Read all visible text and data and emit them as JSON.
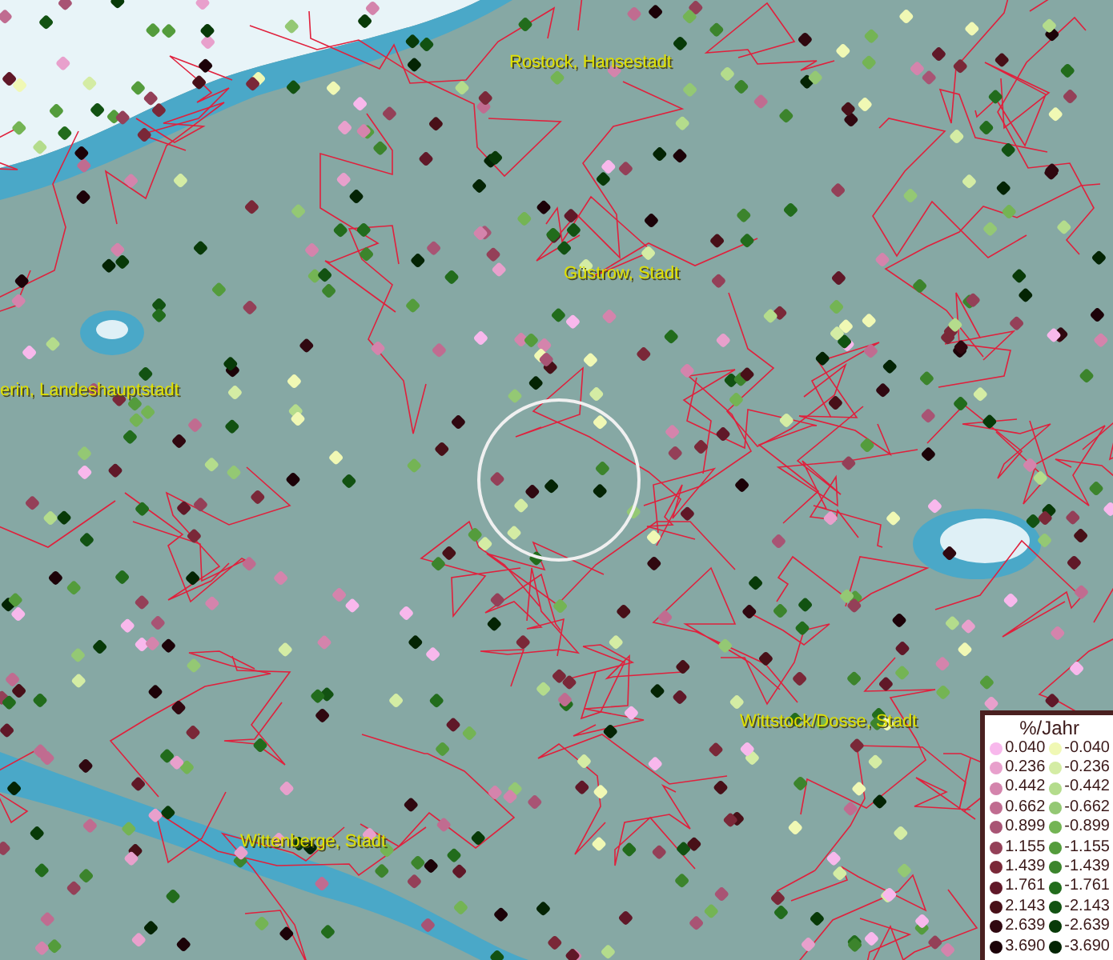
{
  "map": {
    "places": [
      {
        "name": "Rostock, Hansestadt"
      },
      {
        "name": "Güstrow, Stadt"
      },
      {
        "name": "erin, Landeshauptstadt"
      },
      {
        "name": "Wittstock/Dosse, Stadt"
      },
      {
        "name": "Wittenberge, Stadt"
      }
    ]
  },
  "legend": {
    "title": "%/Jahr",
    "increase": [
      {
        "value": "0.040",
        "color": "#f8b8ec"
      },
      {
        "value": "0.236",
        "color": "#e8a0cc"
      },
      {
        "value": "0.442",
        "color": "#d484ac"
      },
      {
        "value": "0.662",
        "color": "#c06c90"
      },
      {
        "value": "0.899",
        "color": "#a85474"
      },
      {
        "value": "1.155",
        "color": "#944058"
      },
      {
        "value": "1.439",
        "color": "#7a2838"
      },
      {
        "value": "1.761",
        "color": "#601828"
      },
      {
        "value": "2.143",
        "color": "#481018"
      },
      {
        "value": "2.639",
        "color": "#300810"
      },
      {
        "value": "3.690",
        "color": "#1c0208"
      }
    ],
    "decrease": [
      {
        "value": "-0.040",
        "color": "#f0f8b4"
      },
      {
        "value": "-0.236",
        "color": "#d4eca4"
      },
      {
        "value": "-0.442",
        "color": "#b4dc8c"
      },
      {
        "value": "-0.662",
        "color": "#94c874"
      },
      {
        "value": "-0.899",
        "color": "#74b454"
      },
      {
        "value": "-1.155",
        "color": "#549c3c"
      },
      {
        "value": "-1.439",
        "color": "#3c842c"
      },
      {
        "value": "-1.761",
        "color": "#226c1c"
      },
      {
        "value": "-2.143",
        "color": "#125212"
      },
      {
        "value": "-2.639",
        "color": "#083a08"
      },
      {
        "value": "-3.690",
        "color": "#042404"
      }
    ]
  }
}
